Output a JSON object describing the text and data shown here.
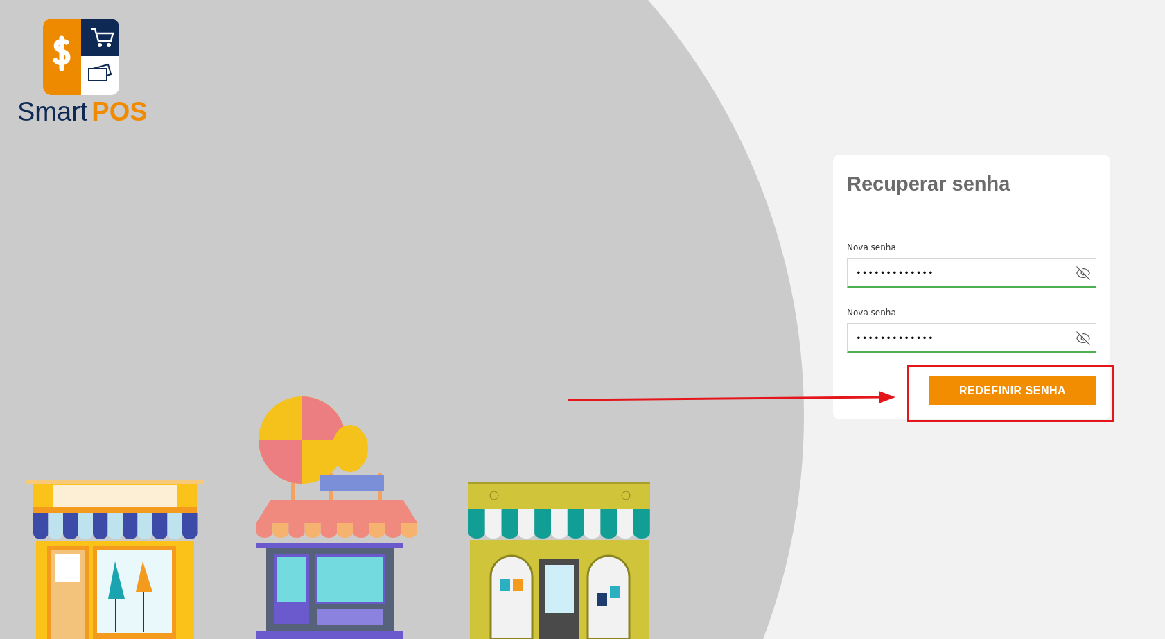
{
  "logo": {
    "name_part_1": "Smart",
    "name_part_2": "POS"
  },
  "card": {
    "title": "Recuperar senha",
    "fields": [
      {
        "label": "Nova senha",
        "value": "•••••••••••••"
      },
      {
        "label": "Nova senha",
        "value": "•••••••••••••"
      }
    ],
    "button": "REDEFINIR SENHA"
  }
}
